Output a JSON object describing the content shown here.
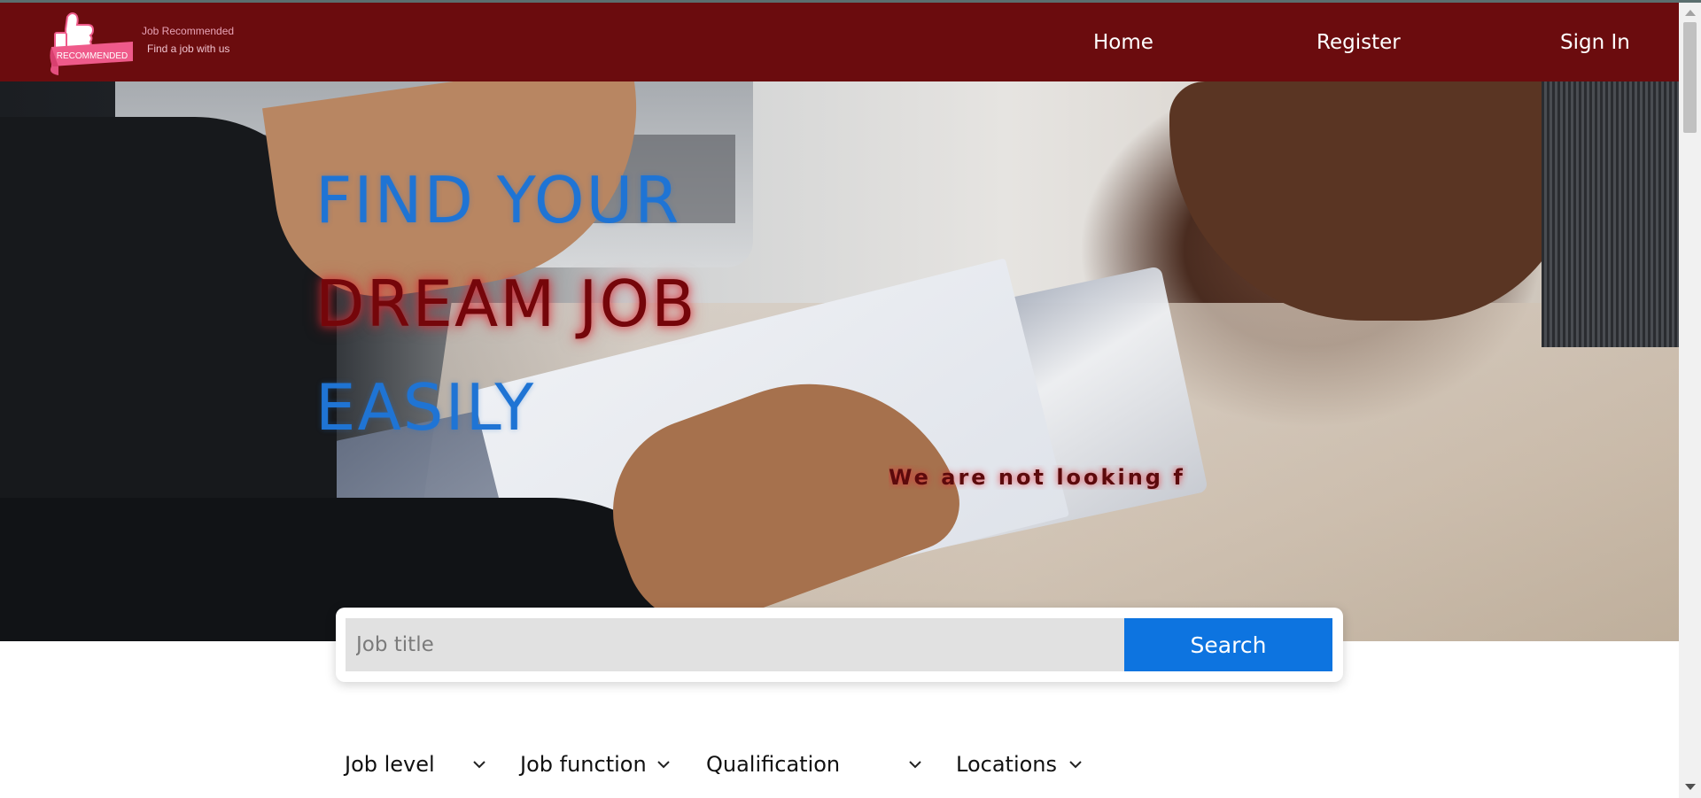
{
  "brand": {
    "name": "Job Recommended",
    "tagline": "Find a job with us",
    "badge_text": "RECOMMENDED",
    "colors": {
      "header_bg": "#6b0c0e",
      "logo_pink": "#ef5a8a"
    }
  },
  "nav": {
    "home": "Home",
    "register": "Register",
    "sign_in": "Sign In"
  },
  "hero": {
    "line1": "FIND YOUR",
    "line2": "DREAM JOB",
    "line3": "EASILY",
    "tagline": "We are not looking f",
    "colors": {
      "blue_text": "#1f74d4",
      "red_text": "#75060a"
    }
  },
  "search": {
    "placeholder": "Job title",
    "value": "",
    "button_label": "Search",
    "button_color": "#0d74e0"
  },
  "filters": [
    {
      "label": "Job level",
      "icon": "chevron-down-icon"
    },
    {
      "label": "Job function",
      "icon": "chevron-down-icon"
    },
    {
      "label": "Qualification",
      "icon": "chevron-down-icon"
    },
    {
      "label": "Locations",
      "icon": "chevron-down-icon"
    }
  ]
}
